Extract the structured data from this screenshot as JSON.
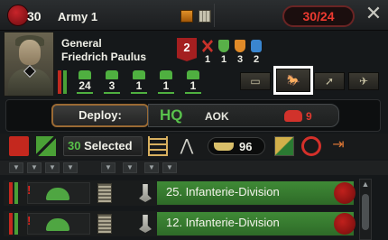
{
  "header": {
    "level": "30",
    "army_name": "Army 1",
    "division_count": "30/24",
    "close_label": "✕"
  },
  "general": {
    "rank": "General",
    "name": "Friedrich Paulus",
    "trait_level": "2",
    "skills": [
      {
        "name": "attack",
        "value": "1",
        "color": "#c8322a"
      },
      {
        "name": "defense",
        "value": "1",
        "color": "#58b048"
      },
      {
        "name": "planning",
        "value": "3",
        "color": "#e08a28"
      },
      {
        "name": "logistics",
        "value": "2",
        "color": "#3a86d0"
      }
    ]
  },
  "composition": [
    {
      "icon": "infantry-icon",
      "value": "24"
    },
    {
      "icon": "artillery-icon",
      "value": "3"
    },
    {
      "icon": "motorized-icon",
      "value": "1"
    },
    {
      "icon": "cavalry-icon",
      "value": "1"
    },
    {
      "icon": "support-icon",
      "value": "1"
    }
  ],
  "orders": [
    {
      "name": "defend-order",
      "icon": "▭"
    },
    {
      "name": "hold-order",
      "icon": "🐎"
    },
    {
      "name": "attack-order",
      "icon": "➚"
    },
    {
      "name": "naval-order",
      "icon": "✈"
    }
  ],
  "deploy": {
    "label": "Deploy:",
    "hq_label": "HQ",
    "hq_name": "AOK",
    "phone_count": "9"
  },
  "toolbar": {
    "selected_count": "30",
    "selected_label": "Selected",
    "transport_count": "96"
  },
  "divisions": [
    {
      "name": "25. Infanterie-Division"
    },
    {
      "name": "12. Infanterie-Division"
    }
  ],
  "colors": {
    "accent_green": "#4aa036",
    "accent_red": "#c4281e"
  }
}
